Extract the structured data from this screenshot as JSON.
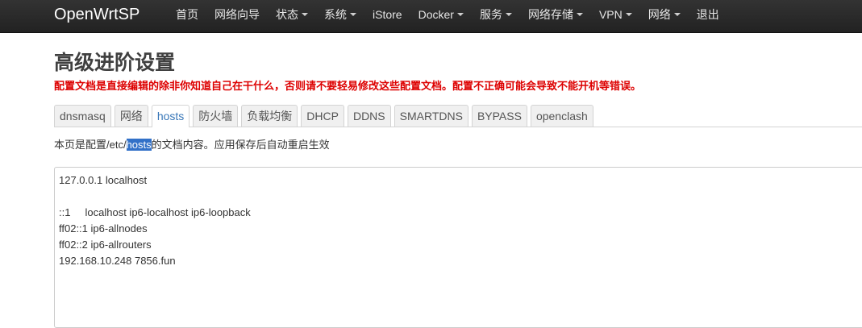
{
  "navbar": {
    "brand": "OpenWrtSP",
    "items": [
      {
        "label": "首页",
        "dropdown": false
      },
      {
        "label": "网络向导",
        "dropdown": false
      },
      {
        "label": "状态",
        "dropdown": true
      },
      {
        "label": "系统",
        "dropdown": true
      },
      {
        "label": "iStore",
        "dropdown": false
      },
      {
        "label": "Docker",
        "dropdown": true
      },
      {
        "label": "服务",
        "dropdown": true
      },
      {
        "label": "网络存储",
        "dropdown": true
      },
      {
        "label": "VPN",
        "dropdown": true
      },
      {
        "label": "网络",
        "dropdown": true
      },
      {
        "label": "退出",
        "dropdown": false
      }
    ]
  },
  "page": {
    "title": "高级进阶设置",
    "warning": "配置文档是直接编辑的除非你知道自己在干什么，否则请不要轻易修改这些配置文档。配置不正确可能会导致不能开机等错误。"
  },
  "tabs": {
    "items": [
      "dnsmasq",
      "网络",
      "hosts",
      "防火墙",
      "负载均衡",
      "DHCP",
      "DDNS",
      "SMARTDNS",
      "BYPASS",
      "openclash"
    ],
    "active": "hosts"
  },
  "description": {
    "prefix": "本页是配置/etc/",
    "highlighted": "hosts",
    "suffix": "的文档内容。应用保存后自动重启生效"
  },
  "editor": {
    "lines": [
      "127.0.0.1 localhost",
      "",
      "::1     localhost ip6-localhost ip6-loopback",
      "ff02::1 ip6-allnodes",
      "ff02::2 ip6-allrouters",
      "192.168.10.248 7856.fun"
    ]
  },
  "colors": {
    "navbar_bg": "#222222",
    "warning_text": "#dd0000",
    "active_tab_text": "#3977b8",
    "selection_bg": "#3271c8"
  }
}
